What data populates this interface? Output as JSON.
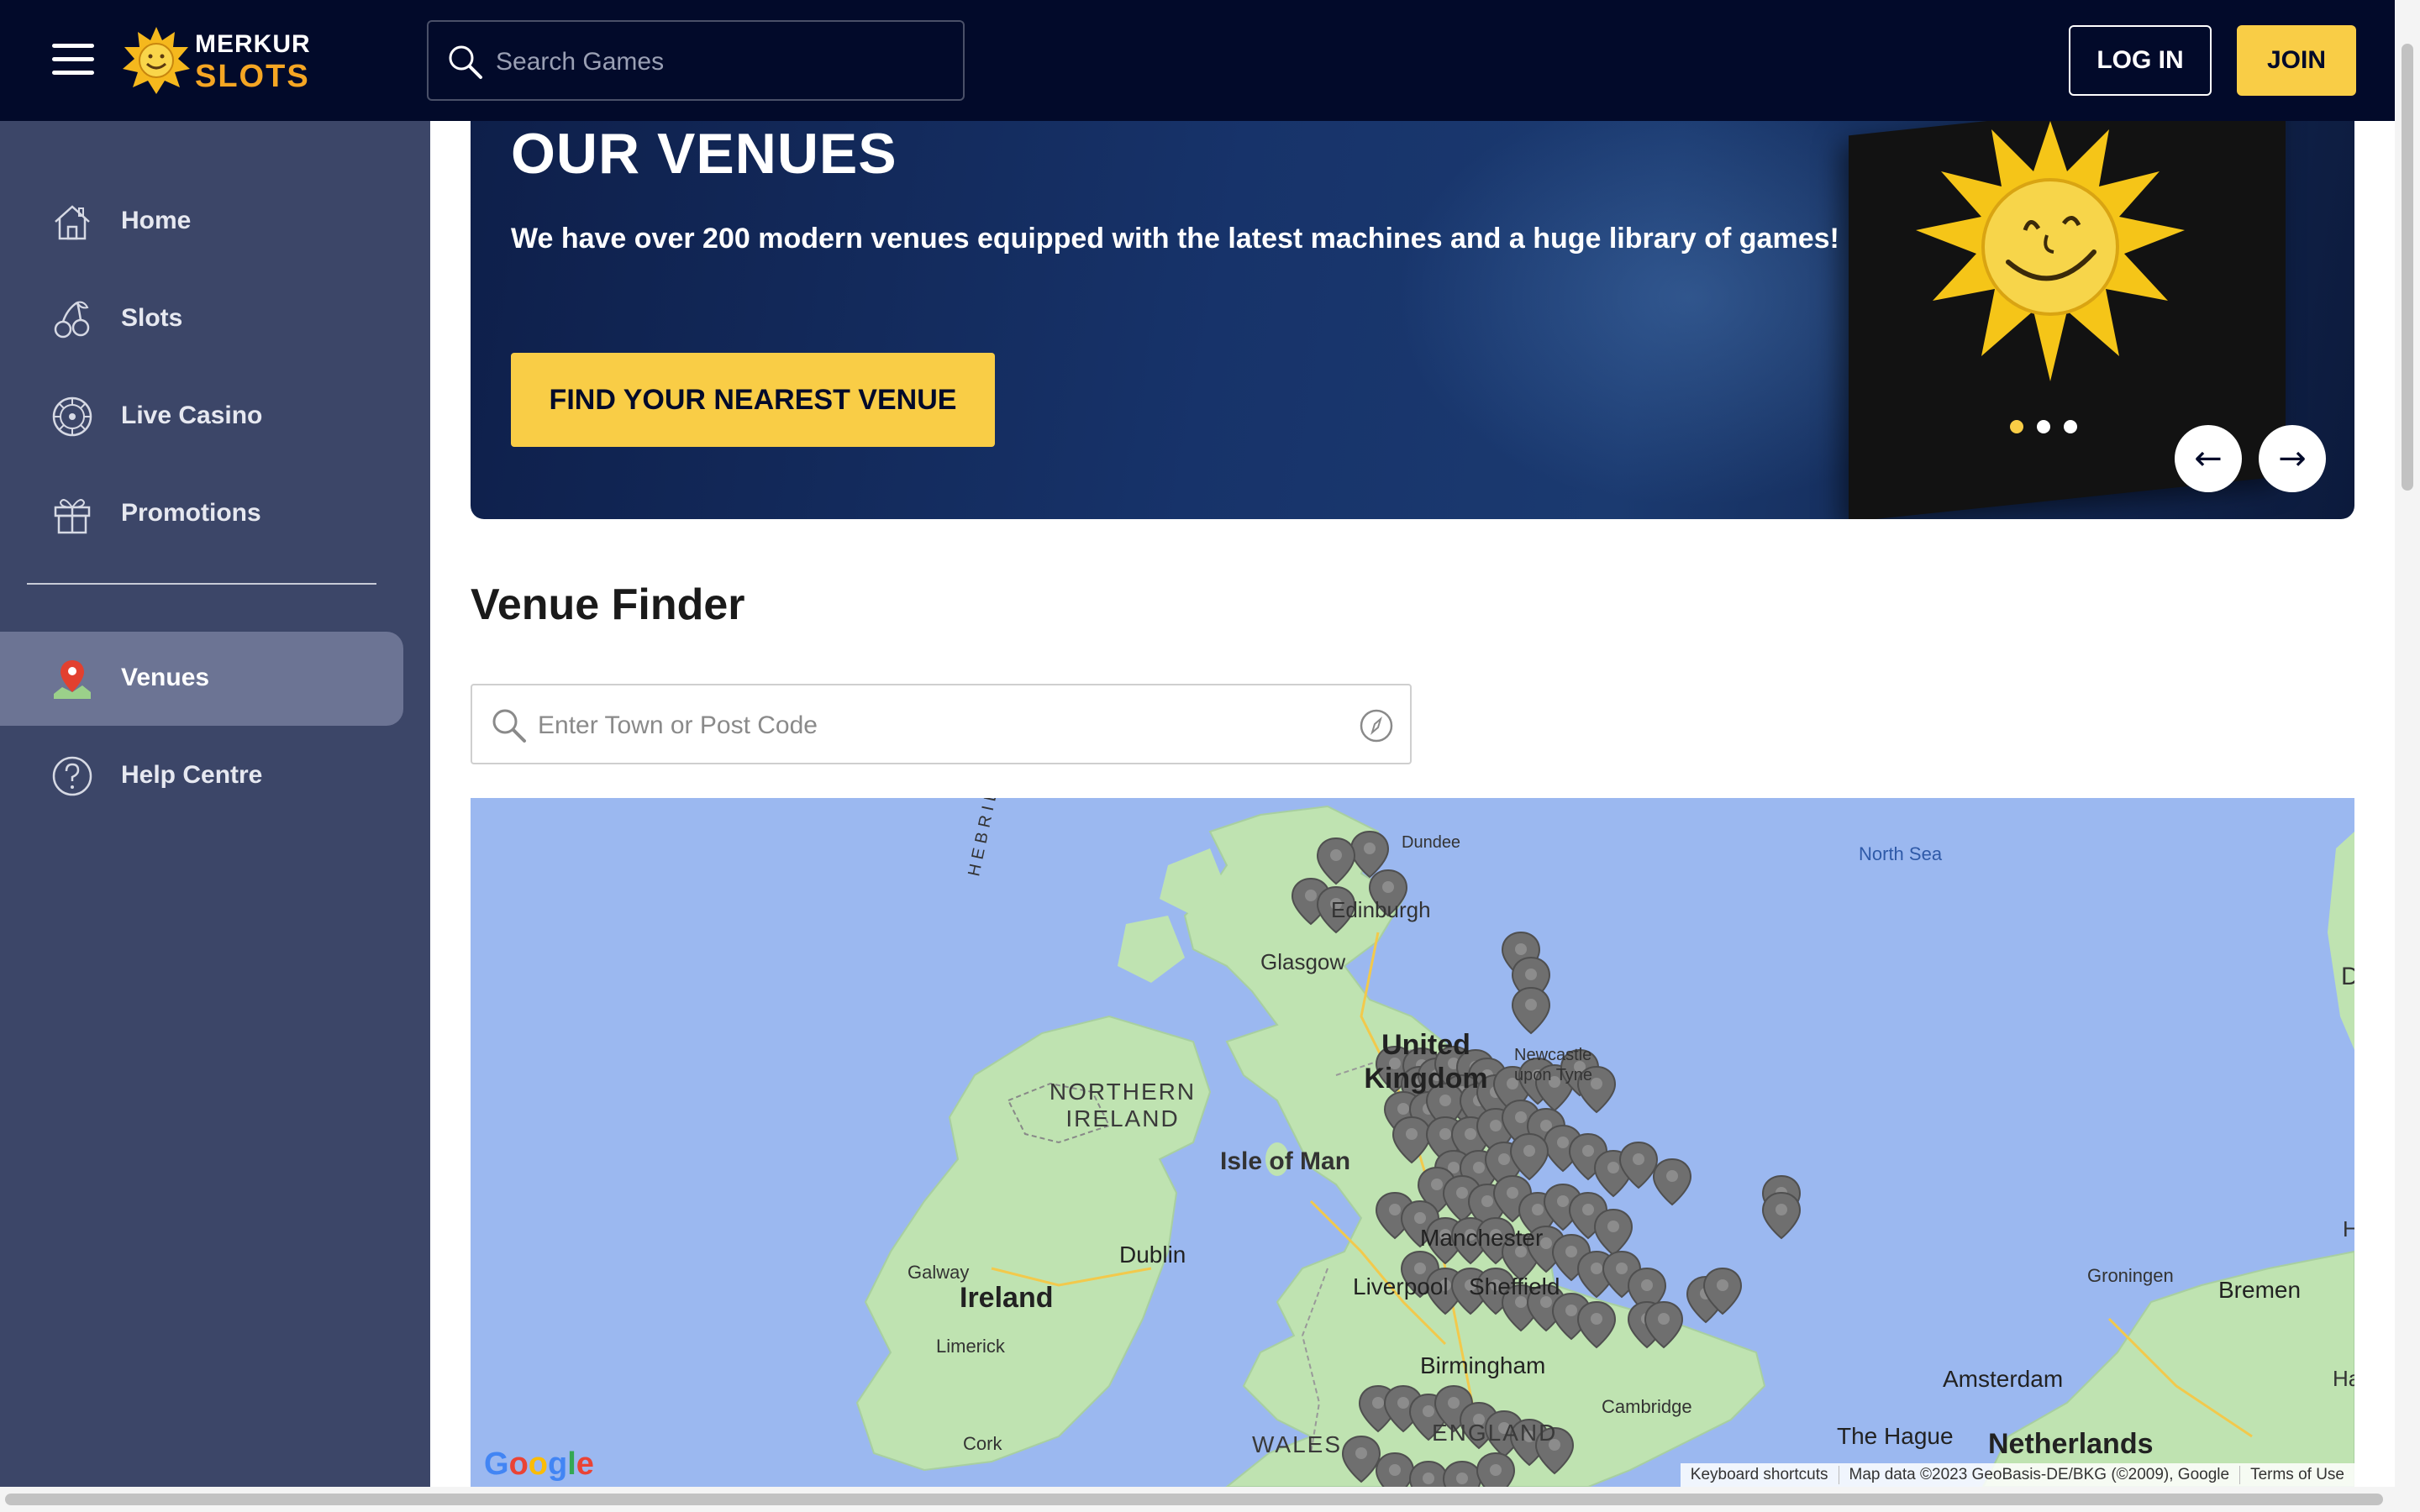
{
  "colors": {
    "topbar_bg": "#020a2a",
    "sidebar_bg": "#3c4668",
    "sidebar_active_bg": "#6c7494",
    "accent_yellow": "#f9cd46",
    "map_water": "#9bb8f0",
    "map_land": "#bfe3b1",
    "map_pin": "#6f6f6f"
  },
  "header": {
    "menu_icon": "hamburger-icon",
    "logo": {
      "line1": "MERKUR",
      "line2": "SLOTS",
      "icon": "sun-icon"
    },
    "search": {
      "placeholder": "Search Games",
      "value": "",
      "icon": "search-icon"
    },
    "login_label": "LOG IN",
    "join_label": "JOIN"
  },
  "sidebar": {
    "items": [
      {
        "label": "Home",
        "icon": "home-icon"
      },
      {
        "label": "Slots",
        "icon": "cherries-icon"
      },
      {
        "label": "Live Casino",
        "icon": "roulette-wheel-icon"
      },
      {
        "label": "Promotions",
        "icon": "gift-icon"
      },
      {
        "label": "Venues",
        "icon": "map-pin-icon",
        "active": true
      },
      {
        "label": "Help Centre",
        "icon": "help-icon"
      }
    ]
  },
  "hero": {
    "title": "OUR VENUES",
    "description": "We have over 200 modern venues equipped with the latest machines and a huge library of games!",
    "cta_label": "FIND YOUR NEAREST VENUE",
    "carousel": {
      "slides": 3,
      "active_slide": 1,
      "prev_icon": "arrow-left-icon",
      "next_icon": "arrow-right-icon"
    }
  },
  "venue_finder": {
    "title": "Venue Finder",
    "search": {
      "placeholder": "Enter Town or Post Code",
      "value": "",
      "icon": "search-icon",
      "locate_icon": "compass-icon"
    }
  },
  "map": {
    "labels": {
      "north_sea": "North Sea",
      "glasgow": "Glasgow",
      "edinburgh": "Edinburgh",
      "dundee": "Dundee",
      "united_kingdom": "United Kingdom",
      "newcastle": "Newcastle upon Tyne",
      "northern_ireland": "NORTHERN IRELAND",
      "isle_of_man": "Isle of Man",
      "ireland": "Ireland",
      "dublin": "Dublin",
      "galway": "Galway",
      "limerick": "Limerick",
      "cork": "Cork",
      "liverpool": "Liverpool",
      "sheffield": "Sheffield",
      "manchester": "Manchester",
      "birmingham": "Birmingham",
      "cambridge": "Cambridge",
      "wales": "WALES",
      "england": "ENGLAND",
      "hebrides": "HEBRIDES",
      "groningen": "Groningen",
      "bremen": "Bremen",
      "amsterdam": "Amsterdam",
      "the_hague": "The Hague",
      "netherlands": "Netherlands",
      "edge_d": "D",
      "edge_h": "H",
      "edge_ha": "Ha"
    },
    "google_logo": "Google",
    "attribution": {
      "shortcuts": "Keyboard shortcuts",
      "data": "Map data ©2023 GeoBasis-DE/BKG (©2009), Google",
      "terms": "Terms of Use"
    },
    "pin_icon": "map-marker-icon"
  }
}
